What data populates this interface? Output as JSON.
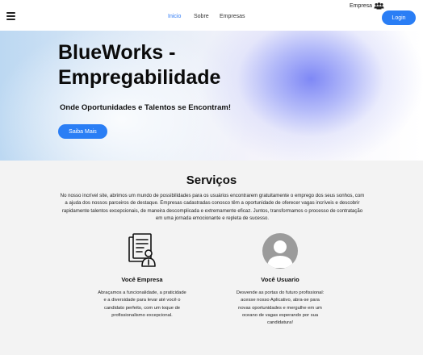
{
  "header": {
    "nav": [
      {
        "label": "Inicio",
        "active": true
      },
      {
        "label": "Sobre",
        "active": false
      },
      {
        "label": "Empresas",
        "active": false
      }
    ],
    "empresa_link": "Empresa",
    "login_label": "Login",
    "menu_icon": "hamburger-menu-icon",
    "empresa_icon": "group-icon"
  },
  "hero": {
    "title": "BlueWorks - Empregabilidade",
    "subtitle": "Onde Oportunidades e Talentos se Encontram!",
    "button_label": "Saiba Mais"
  },
  "services": {
    "title": "Serviços",
    "description": "No nosso incrível site, abrimos um mundo de possibilidades para os usuários encontrarem gratuitamente o emprego dos seus sonhos, com a ajuda dos nossos parceiros de destaque. Empresas cadastradas conosco têm a oportunidade de oferecer vagas incríveis e descobrir rapidamente talentos excepcionais, de maneira descomplicada e extremamente eficaz. Juntos, transformamos o processo de contratação em uma jornada emocionante e repleta de sucesso.",
    "cards": [
      {
        "icon": "company-document-icon",
        "title": "Você Empresa",
        "text": "Abraçamos a funcionalidade, a praticidade e a diversidade para levar até você o candidato perfeito, com um toque de profissionalismo excepcional."
      },
      {
        "icon": "user-avatar-icon",
        "title": "Você Usuario",
        "text": "Desvende as portas do futuro profissional: acesse nosso Aplicativo, abra-se para novas oportunidades e mergulhe em um oceano de vagas esperando por sua candidatura!"
      }
    ]
  },
  "colors": {
    "accent": "#2a7ef5",
    "background": "#f3f3f3"
  }
}
